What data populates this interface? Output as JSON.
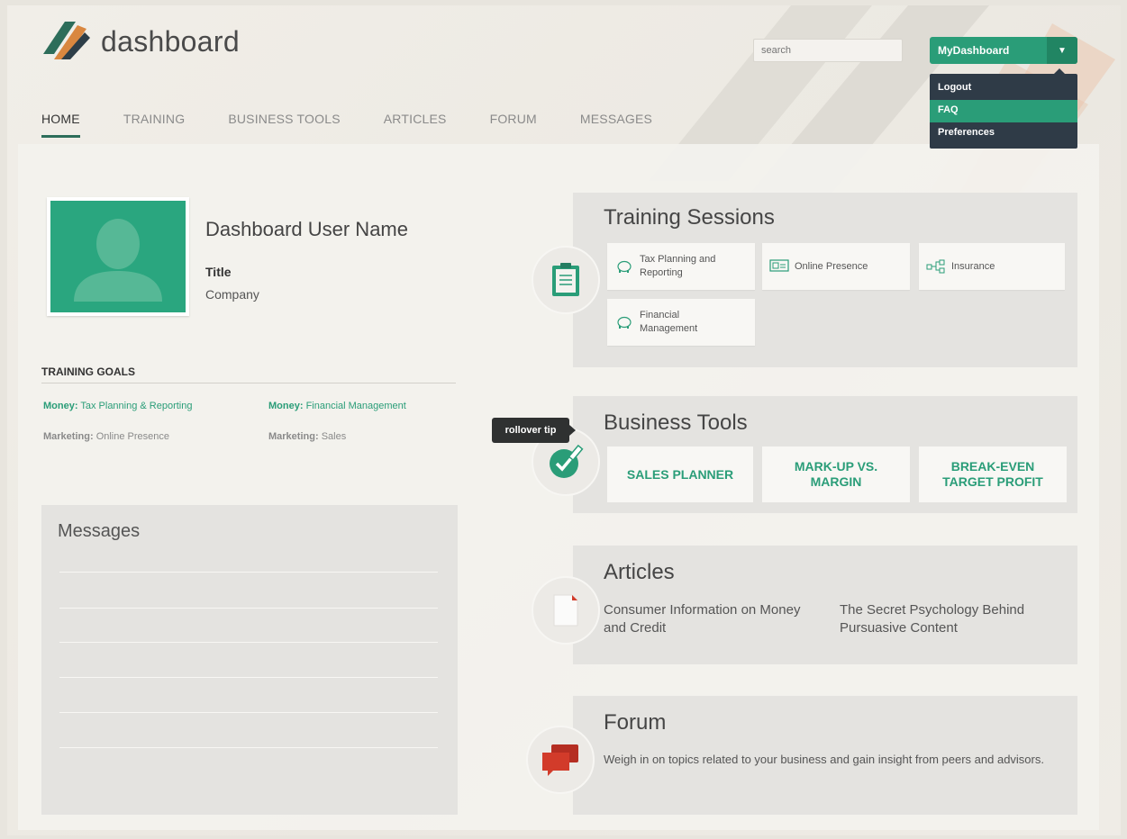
{
  "header": {
    "brand": "dashboard",
    "search_placeholder": "search",
    "account_button": "MyDashboard",
    "account_menu": [
      "Logout",
      "FAQ",
      "Preferences"
    ]
  },
  "nav": [
    "HOME",
    "TRAINING",
    "BUSINESS TOOLS",
    "ARTICLES",
    "FORUM",
    "MESSAGES"
  ],
  "profile": {
    "name": "Dashboard User Name",
    "title": "Title",
    "company": "Company"
  },
  "training_goals": {
    "heading": "TRAINING GOALS",
    "items": [
      {
        "category": "Money:",
        "topic": "Tax Planning & Reporting"
      },
      {
        "category": "Money:",
        "topic": "Financial Management"
      },
      {
        "category": "Marketing:",
        "topic": "Online Presence"
      },
      {
        "category": "Marketing:",
        "topic": "Sales"
      }
    ]
  },
  "messages": {
    "heading": "Messages"
  },
  "training_sessions": {
    "heading": "Training Sessions",
    "items": [
      "Tax Planning and Reporting",
      "Online Presence",
      "Insurance",
      "Financial Management"
    ]
  },
  "business_tools": {
    "heading": "Business Tools",
    "tooltip": "rollover tip",
    "items": [
      "SALES PLANNER",
      "MARK-UP VS. MARGIN",
      "BREAK-EVEN TARGET PROFIT"
    ]
  },
  "articles": {
    "heading": "Articles",
    "items": [
      "Consumer Information on Money and Credit",
      "The Secret Psychology Behind Pursuasive Content"
    ]
  },
  "forum": {
    "heading": "Forum",
    "text": "Weigh in on topics related to your business and gain insight from peers and advisors."
  },
  "colors": {
    "accent": "#2a9d78",
    "accent_dark": "#2d6d5a",
    "menu_bg": "#2f3b47",
    "card_bg": "#e4e3e0",
    "forum_red": "#d23b2a"
  }
}
